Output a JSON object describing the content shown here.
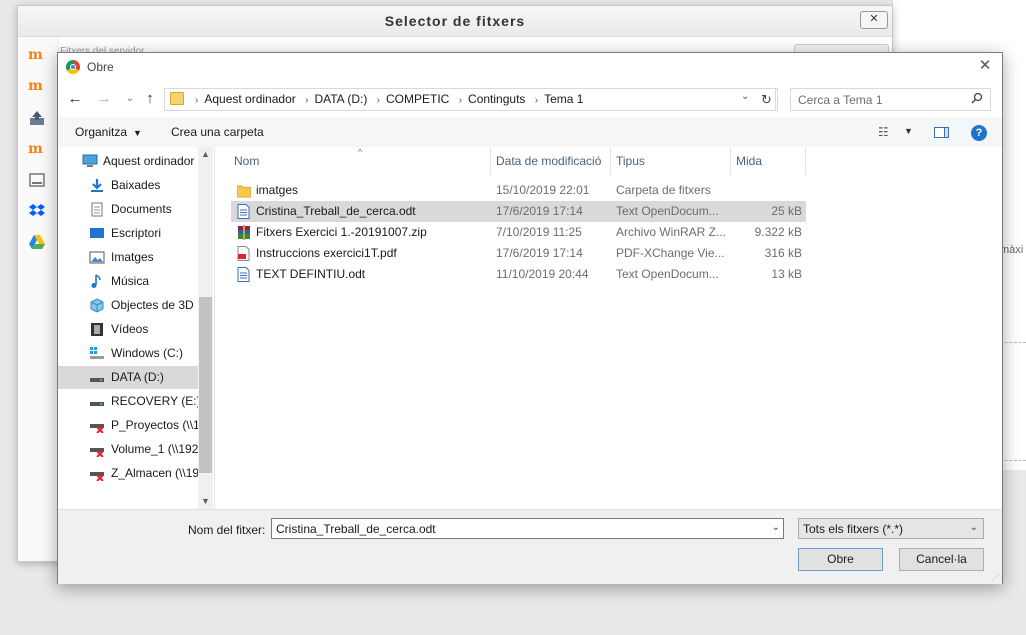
{
  "moodle_dialog": {
    "title": "Selector de fitxers",
    "close_label": "✕",
    "top_text": "Fitxers del servidor"
  },
  "background": {
    "maxim_text": "màxi"
  },
  "open_dialog": {
    "title": "Obre",
    "close_label": "✕",
    "breadcrumbs": [
      "Aquest ordinador",
      "DATA (D:)",
      "COMPETIC",
      "Continguts",
      "Tema 1"
    ],
    "search_placeholder": "Cerca a Tema 1",
    "commands": {
      "organize": "Organitza",
      "new_folder": "Crea una carpeta"
    },
    "nav": [
      {
        "label": "Aquest ordinador",
        "icon": "computer-icon"
      },
      {
        "label": "Baixades",
        "icon": "download-icon"
      },
      {
        "label": "Documents",
        "icon": "documents-icon"
      },
      {
        "label": "Escriptori",
        "icon": "desktop-icon"
      },
      {
        "label": "Imatges",
        "icon": "pictures-icon"
      },
      {
        "label": "Música",
        "icon": "music-icon"
      },
      {
        "label": "Objectes de 3D",
        "icon": "3d-objects-icon"
      },
      {
        "label": "Vídeos",
        "icon": "videos-icon"
      },
      {
        "label": "Windows (C:)",
        "icon": "windows-drive-icon"
      },
      {
        "label": "DATA (D:)",
        "icon": "drive-icon"
      },
      {
        "label": "RECOVERY (E:)",
        "icon": "drive-icon"
      },
      {
        "label": "P_Proyectos (\\\\1",
        "icon": "network-drive-disconnected-icon"
      },
      {
        "label": "Volume_1 (\\\\192",
        "icon": "network-drive-disconnected-icon"
      },
      {
        "label": "Z_Almacen (\\\\19",
        "icon": "network-drive-disconnected-icon"
      }
    ],
    "columns": {
      "name": "Nom",
      "date": "Data de modificació",
      "type": "Tipus",
      "size": "Mida"
    },
    "files": [
      {
        "name": "imatges",
        "date": "15/10/2019 22:01",
        "type": "Carpeta de fitxers",
        "size": "",
        "icon": "folder-icon"
      },
      {
        "name": "Cristina_Treball_de_cerca.odt",
        "date": "17/6/2019 17:14",
        "type": "Text OpenDocum...",
        "size": "25 kB",
        "icon": "odt-file-icon"
      },
      {
        "name": "Fitxers Exercici 1.-20191007.zip",
        "date": "7/10/2019 11:25",
        "type": "Archivo WinRAR Z...",
        "size": "9.322 kB",
        "icon": "winrar-icon"
      },
      {
        "name": "Instruccions exercici1T.pdf",
        "date": "17/6/2019 17:14",
        "type": "PDF-XChange Vie...",
        "size": "316 kB",
        "icon": "pdf-file-icon"
      },
      {
        "name": "TEXT DEFINTIU.odt",
        "date": "11/10/2019 20:44",
        "type": "Text OpenDocum...",
        "size": "13 kB",
        "icon": "odt-file-icon"
      }
    ],
    "filename_label": "Nom del fitxer:",
    "filename_value": "Cristina_Treball_de_cerca.odt",
    "filetype_value": "Tots els fitxers (*.*)",
    "open_button": "Obre",
    "cancel_button": "Cancel·la"
  }
}
